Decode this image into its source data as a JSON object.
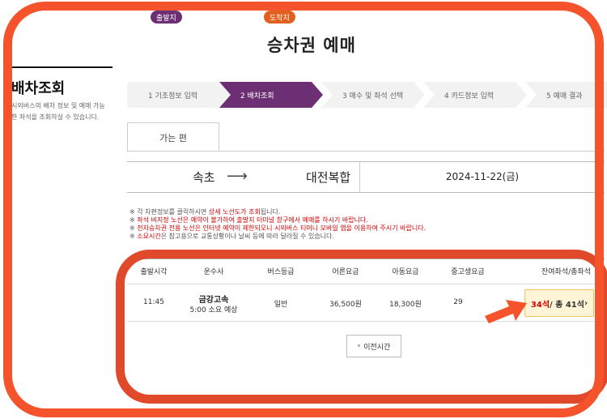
{
  "page": {
    "title": "승차권 예매"
  },
  "sidebar": {
    "title": "배차조회",
    "description": "시외버스의 배차 정보 및 예매 가능한 좌석을 조회하실 수 있습니다."
  },
  "steps": [
    {
      "label": "1 기초정보 입력"
    },
    {
      "label": "2 배차조회"
    },
    {
      "label": "3 매수 및 좌석 선택"
    },
    {
      "label": "4 카드정보 입력"
    },
    {
      "label": "5 예매 결과"
    }
  ],
  "tabs": {
    "outbound": "가는 편"
  },
  "route": {
    "departure_badge": "출발지",
    "departure": "속초",
    "arrow": "⟶",
    "arrival_badge": "도착지",
    "arrival": "대전복합",
    "date": "2024-11-22(금)"
  },
  "notes": [
    {
      "prefix": "※ 각 차편정보를 클릭하시면 ",
      "red": "상세 노선도가 조회",
      "suffix": "됩니다."
    },
    {
      "prefix": "※ ",
      "red": "좌석 비지정 노선은 예약이 불가하여 출발지 터미널 창구에서 예매를 하시기 바랍니다.",
      "suffix": ""
    },
    {
      "prefix": "※ ",
      "red": "전자승차권 전용 노선은 인터넷 예약이 제한되오니 시외버스 티머니 모바일 앱을 이용하여 주시기 바랍니다.",
      "suffix": ""
    },
    {
      "prefix": "※ ",
      "red": "소요시간",
      "suffix": "은 참고용으로 교통상황이나 날씨 등에 따라 달라질 수 있습니다."
    }
  ],
  "table": {
    "headers": {
      "depart_time": "출발시각",
      "company": "운수사",
      "bus_class": "버스등급",
      "adult_fare": "어른요금",
      "child_fare": "아동요금",
      "student_fare": "중고생요금",
      "seats": "잔여좌석/총좌석"
    },
    "rows": [
      {
        "depart_time": "11:45",
        "company": "금강고속",
        "duration": "5:00 소요 예상",
        "bus_class": "일반",
        "adult_fare": "36,500원",
        "child_fare": "18,300원",
        "student_fare": "29",
        "seats_available": "34석",
        "seats_total": " / 총 41석",
        "seats_arrow": "›"
      }
    ]
  },
  "buttons": {
    "prev_time": "이전시간",
    "prev_icon": "‹"
  },
  "colors": {
    "accent": "#6d2f73",
    "annotation": "#f4532b",
    "arrival_badge": "#e2601f"
  },
  "icons": {
    "pointer": "red-arrow-icon"
  }
}
